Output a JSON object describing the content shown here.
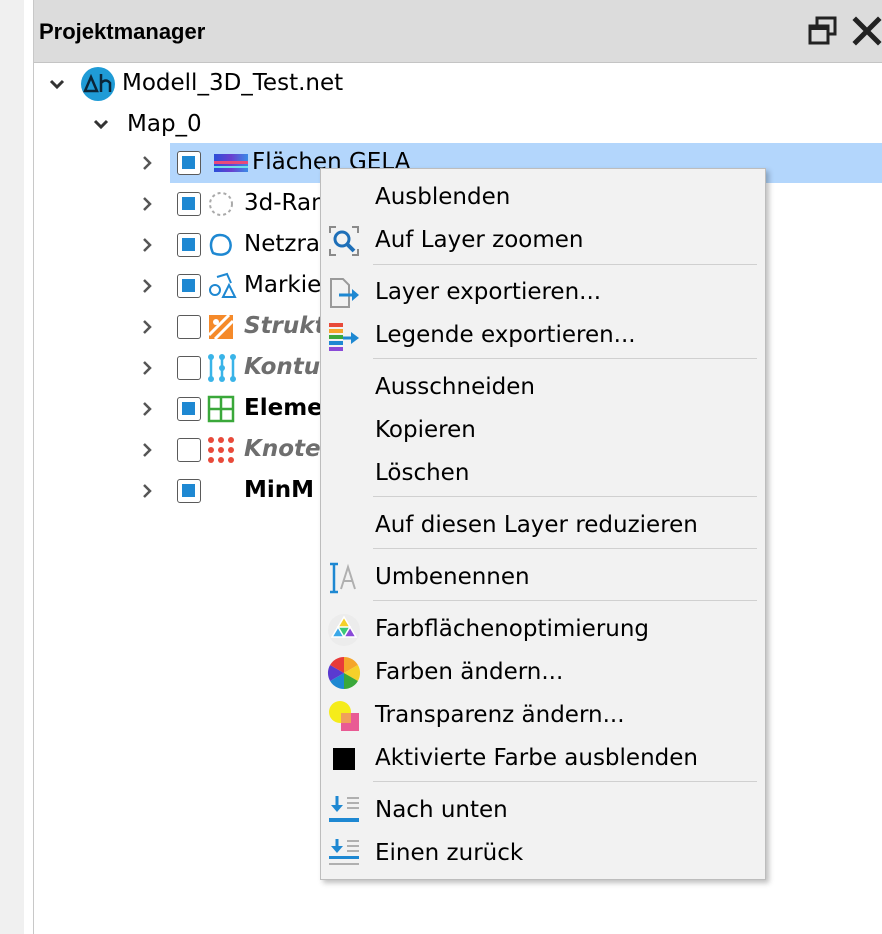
{
  "panel": {
    "title": "Projektmanager"
  },
  "tree": {
    "project": "Modell_3D_Test.net",
    "map": "Map_0",
    "layers": [
      {
        "label": "Flächen GELA",
        "checked": true
      },
      {
        "label": "3d-Ran",
        "checked": true
      },
      {
        "label": "Netzra",
        "checked": true
      },
      {
        "label": "Markie",
        "checked": true
      },
      {
        "label": "Strukt",
        "checked": false
      },
      {
        "label": "Kontu",
        "checked": false
      },
      {
        "label": "Eleme",
        "checked": true
      },
      {
        "label": "Knoten",
        "checked": false
      },
      {
        "label": "MinM",
        "checked": true
      }
    ]
  },
  "context_menu": {
    "items": [
      {
        "label": "Ausblenden",
        "icon": "none"
      },
      {
        "label": "Auf Layer zoomen",
        "icon": "zoom-layer-icon"
      },
      {
        "label": "Layer exportieren...",
        "icon": "export-layer-icon"
      },
      {
        "label": "Legende exportieren...",
        "icon": "export-legend-icon"
      },
      {
        "label": "Ausschneiden",
        "icon": "none"
      },
      {
        "label": "Kopieren",
        "icon": "none"
      },
      {
        "label": "Löschen",
        "icon": "none"
      },
      {
        "label": "Auf diesen Layer reduzieren",
        "icon": "none"
      },
      {
        "label": "Umbenennen",
        "icon": "rename-icon"
      },
      {
        "label": "Farbflächenoptimierung",
        "icon": "color-optimize-icon"
      },
      {
        "label": "Farben ändern...",
        "icon": "color-wheel-icon"
      },
      {
        "label": "Transparenz ändern...",
        "icon": "transparency-icon"
      },
      {
        "label": "Aktivierte Farbe ausblenden",
        "icon": "black-square-icon"
      },
      {
        "label": "Nach unten",
        "icon": "move-down-icon"
      },
      {
        "label": "Einen zurück",
        "icon": "move-back-icon"
      }
    ]
  },
  "colors": {
    "selection": "#b3d6fc",
    "checkbox_fill": "#1e88d2",
    "accent_blue": "#1e88d2"
  }
}
